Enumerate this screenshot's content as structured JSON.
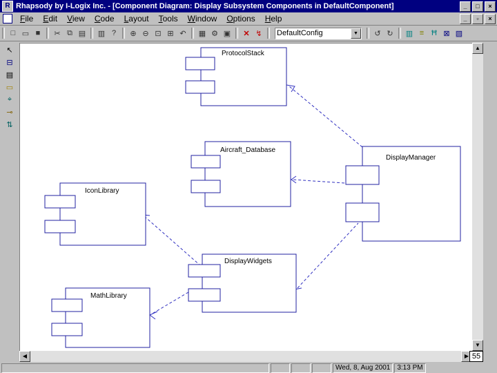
{
  "window": {
    "title": "Rhapsody by I-Logix Inc. - [Component Diagram: Display Subsystem Components in DefaultComponent]",
    "app_icon": "R"
  },
  "menu": [
    "File",
    "Edit",
    "View",
    "Code",
    "Layout",
    "Tools",
    "Window",
    "Options",
    "Help"
  ],
  "toolbar": {
    "config_combo_value": "DefaultConfig",
    "icons": [
      "new-icon",
      "open-icon",
      "save-icon",
      "cut-icon",
      "copy-icon",
      "paste-icon",
      "print-icon",
      "help-icon",
      "zoom-in-icon",
      "zoom-out-icon",
      "zoom-fit-icon",
      "zoom-select-icon",
      "undo-zoom-icon",
      "generate-icon",
      "make-icon",
      "run-icon",
      "stop-icon",
      "animate-icon",
      "back-icon",
      "forward-icon",
      "browser-icon",
      "features-icon",
      "hierarchy-icon"
    ]
  },
  "diagram": {
    "components": [
      {
        "id": "protocol",
        "name": "ProtocolStack"
      },
      {
        "id": "aircraft",
        "name": "Aircraft_Database"
      },
      {
        "id": "iconlib",
        "name": "IconLibrary"
      },
      {
        "id": "display",
        "name": "DisplayManager"
      },
      {
        "id": "widgets",
        "name": "DisplayWidgets"
      },
      {
        "id": "mathlib",
        "name": "MathLibrary"
      }
    ]
  },
  "status": {
    "datetime": "Wed, 8, Aug 2001",
    "time": "3:13 PM"
  },
  "page_number": "55"
}
